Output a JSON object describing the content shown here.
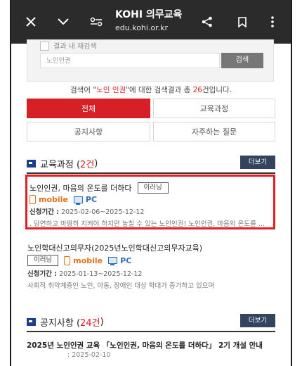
{
  "browser": {
    "title": "KOHI 의무교육",
    "url": "edu.kohi.or.kr"
  },
  "search": {
    "checkbox_label": "결과 내 재검색",
    "input_value": "노인인권",
    "button_label": "검색"
  },
  "summary": {
    "prefix": "검색어 \"",
    "keyword": "노인 인권",
    "middle": "\"에 대한 검색결과 총 ",
    "count": "26",
    "suffix": "건입니다."
  },
  "tabs": [
    {
      "label": "전체",
      "active": true
    },
    {
      "label": "교육과정",
      "active": false
    },
    {
      "label": "공지사항",
      "active": false
    },
    {
      "label": "자주하는 질문",
      "active": false
    }
  ],
  "courses_section": {
    "title": "교육과정 (",
    "count": "2건",
    "close": ")",
    "more_label": "더보기"
  },
  "courses": [
    {
      "title": "노인인권, 마음의 온도를 더하다",
      "tag": "이러닝",
      "mobile": "mobile",
      "pc": "PC",
      "period_label": "신청기간 :",
      "period": " 2025-02-06~2025-12-12",
      "desc": ". 당연하고 마땅히 지켜야 하지만 놓칠 수 있는 노인인권! 노인인권, 마음의 온도를 더하다"
    },
    {
      "title": "노인학대신고의무자(2025년노인학대신고의무자교육)",
      "tag": "이러닝",
      "mobile": "mobile",
      "pc": "PC",
      "period_label": "신청기간 :",
      "period": " 2025-01-13~2025-12-12",
      "desc": "사회적 취약계층인 노인, 아동, 장애인 대상 학대가 증가하고 있으며"
    }
  ],
  "notices_section": {
    "title": "공지사항 (",
    "count": "24건",
    "close": ")",
    "more_label": "더보기"
  },
  "notices": [
    {
      "title": "2025년 노인인권 교육 「노인인권, 마음의 온도를 더하다」 2기 개설 안내",
      "date": ": 2025-02-10"
    }
  ]
}
